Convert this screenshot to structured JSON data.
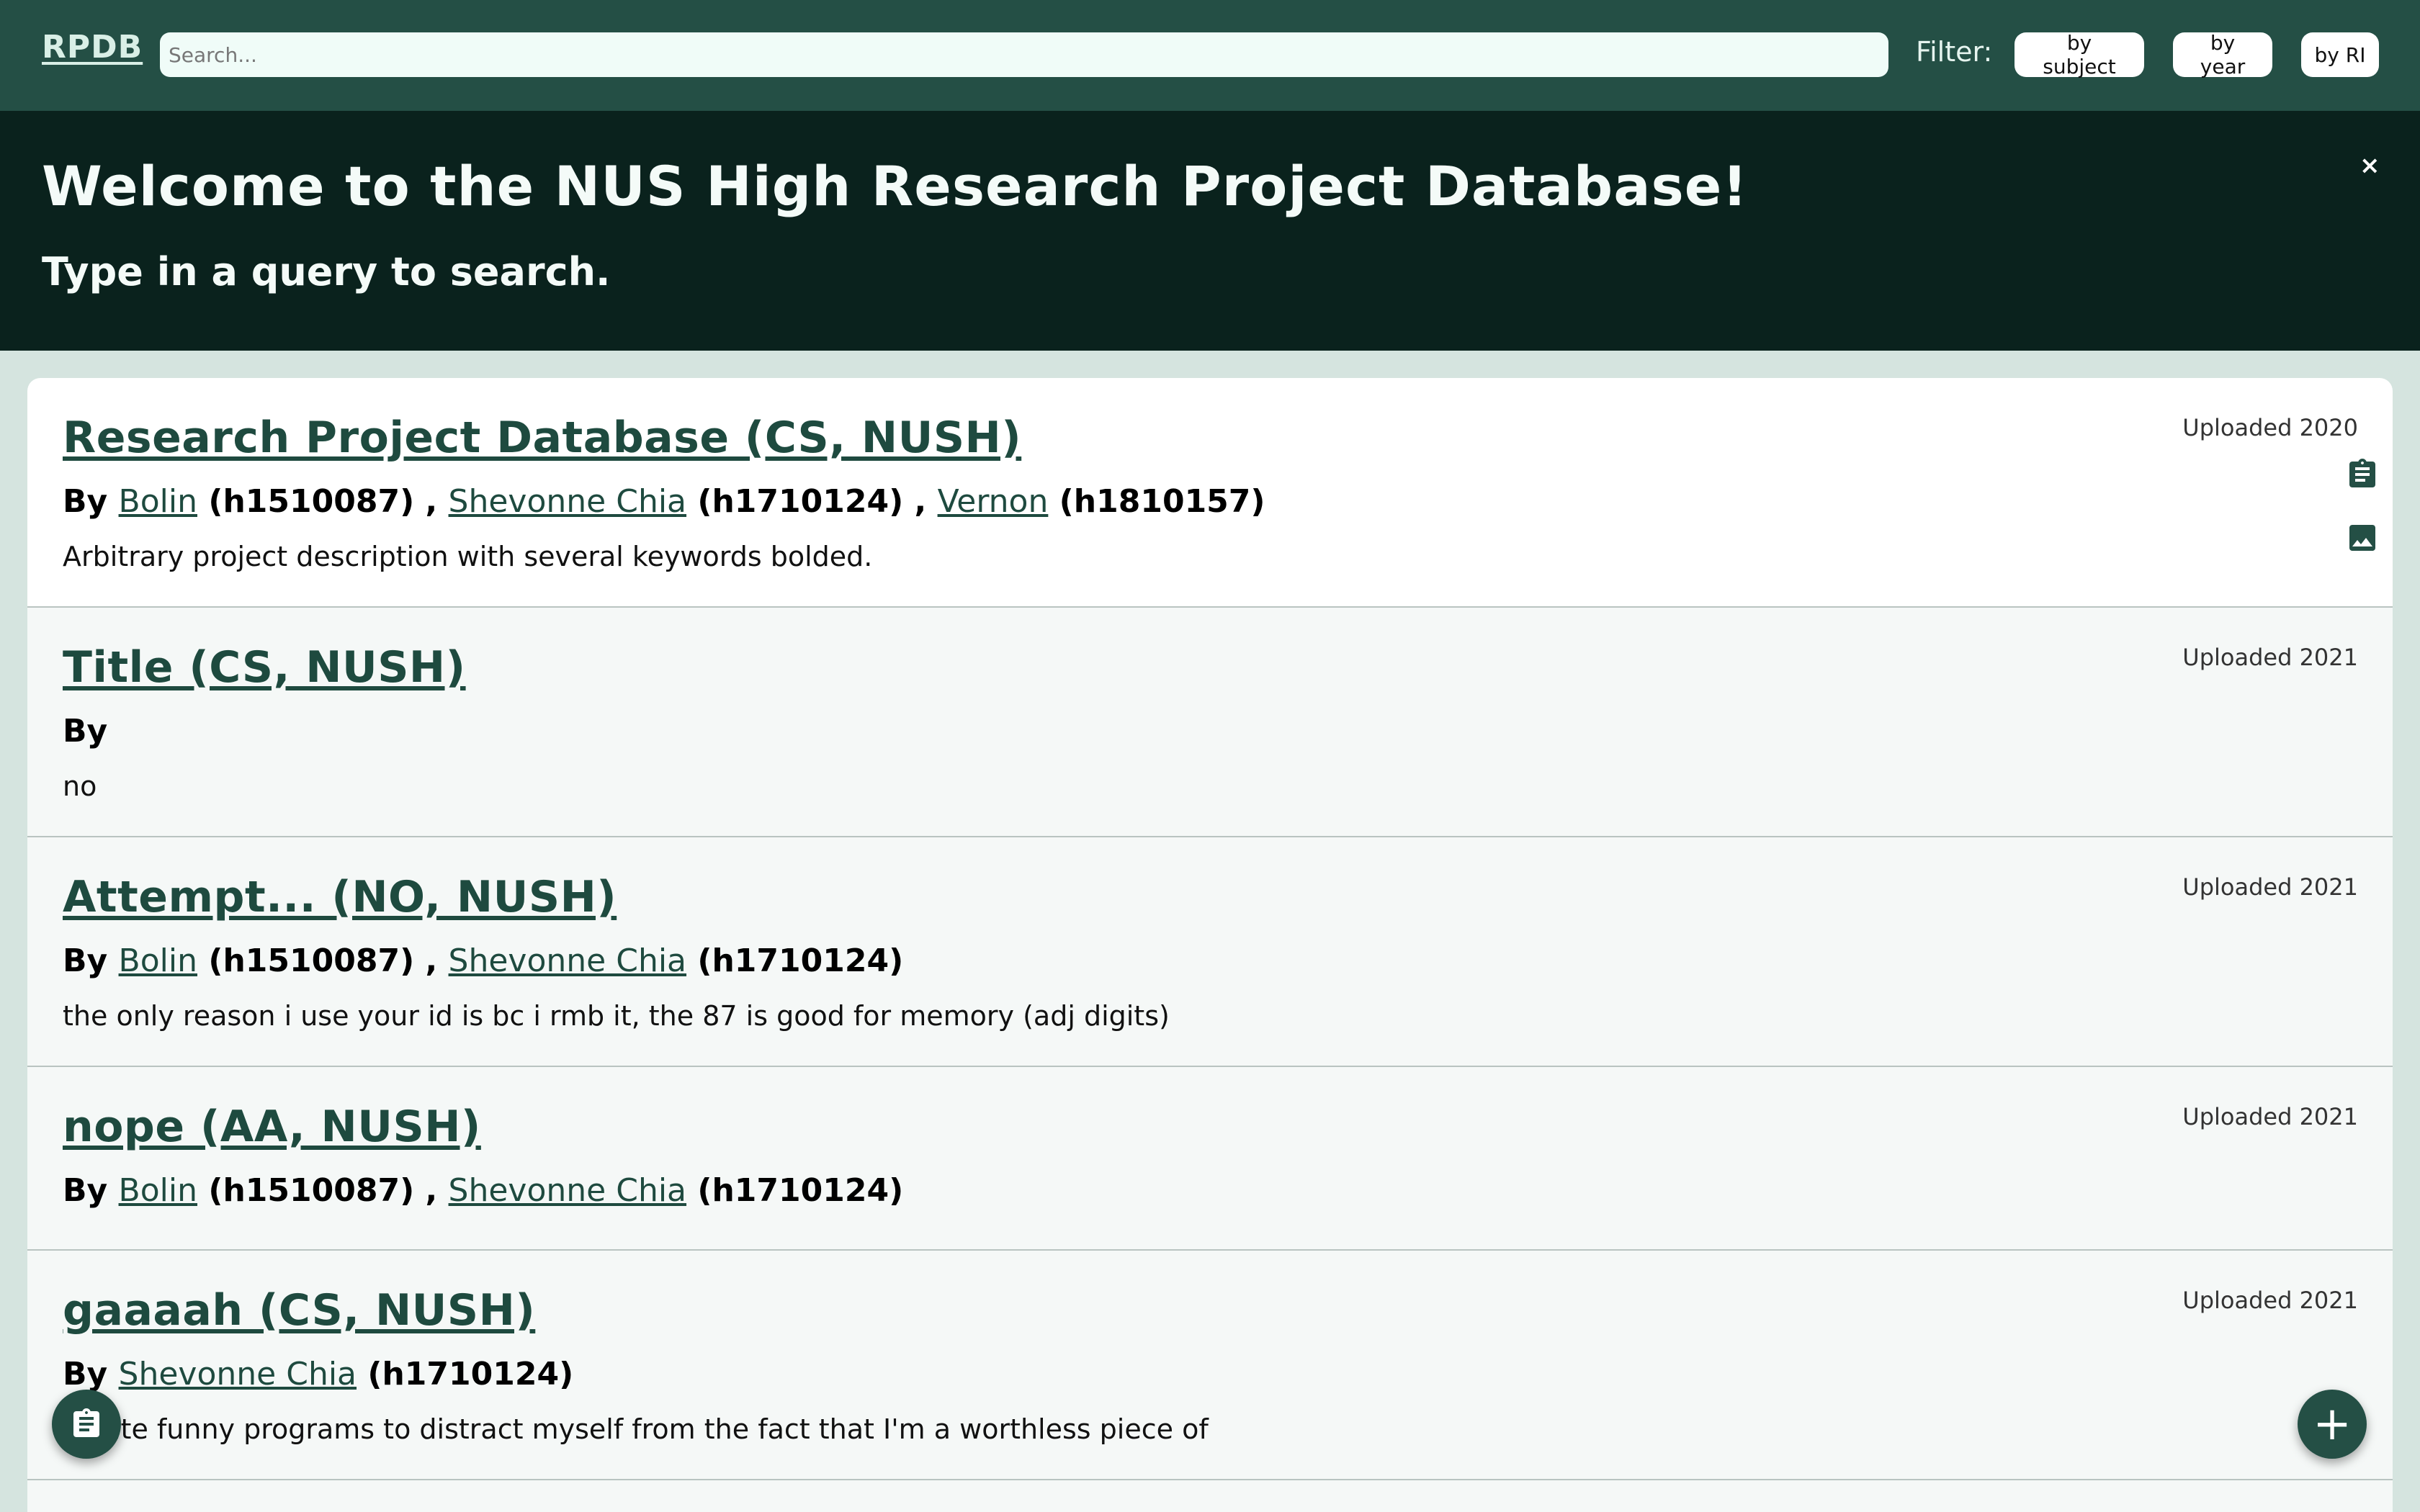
{
  "header": {
    "brand": "RPDB",
    "search_placeholder": "Search...",
    "filter_label": "Filter:",
    "filters": [
      "by subject",
      "by year",
      "by RI"
    ]
  },
  "banner": {
    "title": "Welcome to the NUS High Research Project Database!",
    "subtitle": "Type in a query to search.",
    "close": "×"
  },
  "projects": [
    {
      "title": "Research Project Database (CS, NUSH)",
      "by": "By",
      "authors": [
        {
          "name": "Bolin",
          "id": "(h1510087)"
        },
        {
          "name": "Shevonne Chia",
          "id": "(h1710124)"
        },
        {
          "name": "Vernon",
          "id": "(h1810157)"
        }
      ],
      "description": "Arbitrary project description with several keywords bolded.",
      "uploaded": "Uploaded 2020",
      "icons": [
        "clipboard-icon",
        "image-icon"
      ]
    },
    {
      "title": "Title (CS, NUSH)",
      "by": "By",
      "authors": [],
      "description": "no",
      "uploaded": "Uploaded 2021"
    },
    {
      "title": "Attempt... (NO, NUSH)",
      "by": "By",
      "authors": [
        {
          "name": "Bolin",
          "id": "(h1510087)"
        },
        {
          "name": "Shevonne Chia",
          "id": "(h1710124)"
        }
      ],
      "description": "the only reason i use your id is bc i rmb it, the 87 is good for memory (adj digits)",
      "uploaded": "Uploaded 2021"
    },
    {
      "title": "nope (AA, NUSH)",
      "by": "By",
      "authors": [
        {
          "name": "Bolin",
          "id": "(h1510087)"
        },
        {
          "name": "Shevonne Chia",
          "id": "(h1710124)"
        }
      ],
      "description": "",
      "uploaded": "Uploaded 2021"
    },
    {
      "title": "gaaaah (CS, NUSH)",
      "by": "By",
      "authors": [
        {
          "name": "Shevonne Chia",
          "id": "(h1710124)"
        }
      ],
      "description": "I write funny programs to distract myself from the fact that I'm a worthless piece of",
      "uploaded": "Uploaded 2021"
    }
  ],
  "fabs": {
    "left_icon": "clipboard-icon",
    "right_icon": "plus-icon",
    "right_symbol": "+"
  },
  "colors": {
    "header_bg": "#244f45",
    "banner_bg": "#0a221d",
    "accent": "#1e4a3f",
    "page_bg": "#d5e4df"
  }
}
